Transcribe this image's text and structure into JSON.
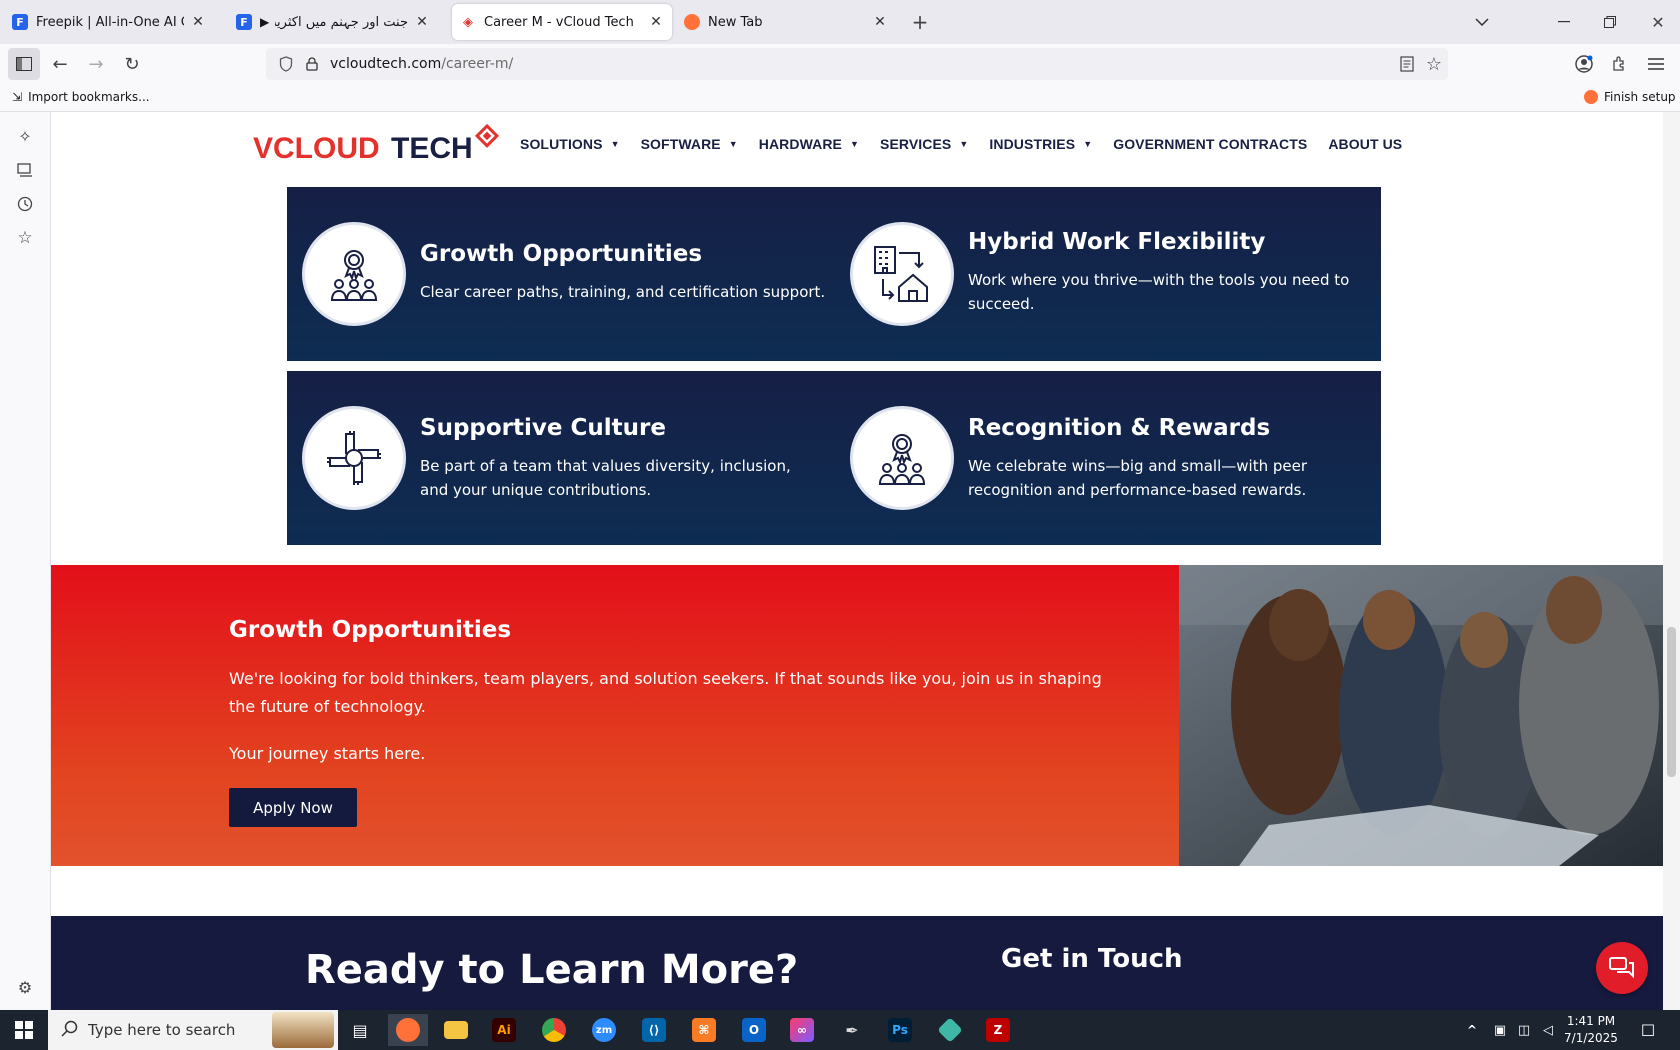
{
  "browser": {
    "tabs": [
      {
        "title": "Freepik | All-in-One AI Creative",
        "favicon_color": "#1f6feb",
        "active": false
      },
      {
        "title": "جنت اور جہنم میں اکثریت ک",
        "favicon_color": "#1f6feb",
        "active": false
      },
      {
        "title": "Career M - vCloud Tech",
        "favicon_color": "#e4312b",
        "active": true
      },
      {
        "title": "New Tab",
        "favicon_color": "#ff7139",
        "active": false
      }
    ],
    "url_host": "vcloudtech.com",
    "url_path": "/career-m/",
    "bookmarks": {
      "import_label": "Import bookmarks...",
      "finish_setup_label": "Finish setup"
    }
  },
  "site": {
    "logo_text_a": "VCLOUD",
    "logo_text_b": "TECH",
    "nav": [
      {
        "label": "SOLUTIONS",
        "dropdown": true
      },
      {
        "label": "SOFTWARE",
        "dropdown": true
      },
      {
        "label": "HARDWARE",
        "dropdown": true
      },
      {
        "label": "SERVICES",
        "dropdown": true
      },
      {
        "label": "INDUSTRIES",
        "dropdown": true
      },
      {
        "label": "GOVERNMENT CONTRACTS",
        "dropdown": false
      },
      {
        "label": "ABOUT US",
        "dropdown": false
      }
    ],
    "benefits": [
      {
        "title": "Growth Opportunities",
        "desc": "Clear career paths, training, and certification support.",
        "icon": "award-team-icon"
      },
      {
        "title": "Hybrid Work Flexibility",
        "desc": "Work where you thrive—with the tools you need to succeed.",
        "icon": "office-home-icon"
      },
      {
        "title": "Supportive Culture",
        "desc": "Be part of a team that values diversity, inclusion, and your unique contributions.",
        "icon": "hands-together-icon"
      },
      {
        "title": "Recognition & Rewards",
        "desc": "We celebrate wins—big and small—with peer recognition and performance-based rewards.",
        "icon": "award-team-icon"
      }
    ],
    "cta": {
      "title": "Growth Opportunities",
      "body": "We're looking for bold thinkers, team players, and solution seekers. If that sounds like you, join us in shaping the future of technology.",
      "tagline": "Your journey starts here.",
      "button": "Apply Now"
    },
    "footer": {
      "left_title": "Ready to Learn More?",
      "right_title": "Get in Touch"
    },
    "colors": {
      "navy": "#161f46",
      "red": "#e30f1a",
      "accent_red": "#e4312b"
    }
  },
  "taskbar": {
    "search_placeholder": "Type here to search",
    "time": "1:41 PM",
    "date": "7/1/2025",
    "apps": [
      "taskview",
      "firefox",
      "explorer",
      "illustrator",
      "chrome",
      "zoom",
      "vscode",
      "xampp",
      "outlook",
      "creative-cloud",
      "pen-tool",
      "photoshop",
      "app-diamond",
      "filezilla"
    ]
  }
}
